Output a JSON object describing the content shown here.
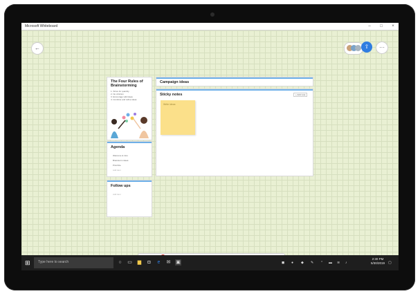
{
  "window": {
    "title": "Microsoft Whiteboard",
    "minimize": "–",
    "maximize": "□",
    "close": "×"
  },
  "canvas": {
    "back_icon": "←",
    "share_icon": "⇧",
    "settings_icon": "···"
  },
  "cards": {
    "rules_title": "The Four Rules of Brainstorming",
    "rules": [
      "1. Strive for quantity",
      "2. No criticism",
      "3. Encourage wild ideas",
      "4. Combine and refine ideas"
    ],
    "agenda_title": "Agenda",
    "agenda_items": [
      "Welcome & intro",
      "Brainstorm ideas",
      "Prioritize",
      "Add item"
    ],
    "followups_title": "Follow ups",
    "followup_item": "Add item",
    "campaign_title": "Campaign ideas",
    "sticky_title": "Sticky notes",
    "sticky_btn": "+ Add note",
    "sticky_placeholder": "Write ideas"
  },
  "taskbar": {
    "search_placeholder": "Type here to search",
    "time": "2:30 PM",
    "date": "5/30/2019"
  },
  "colors": {
    "accent": "#2f7de1",
    "sticky": "#fbe08a",
    "canvas": "#e9f0d3"
  }
}
